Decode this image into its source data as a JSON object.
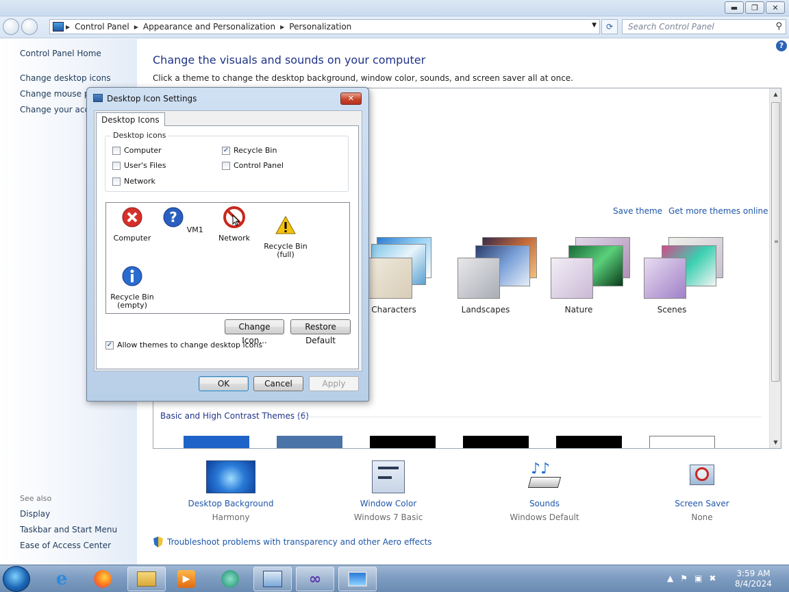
{
  "address_bar": {
    "segments": [
      "Control Panel",
      "Appearance and Personalization",
      "Personalization"
    ],
    "search_placeholder": "Search Control Panel"
  },
  "left_pane": {
    "home": "Control Panel Home",
    "links": [
      "Change desktop icons",
      "Change mouse po",
      "Change your acco"
    ],
    "see_also_label": "See also",
    "see_also": [
      "Display",
      "Taskbar and Start Menu",
      "Ease of Access Center"
    ]
  },
  "main": {
    "title": "Change the visuals and sounds on your computer",
    "subtitle": "Click a theme to change the desktop background, window color, sounds, and screen saver all at once.",
    "save_theme": "Save theme",
    "get_more": "Get more themes online",
    "themes": [
      "Characters",
      "Landscapes",
      "Nature",
      "Scenes"
    ],
    "basic_header": "Basic and High Contrast Themes (6)",
    "help": "?"
  },
  "bottom": {
    "items": [
      {
        "label": "Desktop Background",
        "value": "Harmony"
      },
      {
        "label": "Window Color",
        "value": "Windows 7 Basic"
      },
      {
        "label": "Sounds",
        "value": "Windows Default"
      },
      {
        "label": "Screen Saver",
        "value": "None"
      }
    ],
    "troubleshoot": "Troubleshoot problems with transparency and other Aero effects"
  },
  "dialog": {
    "title": "Desktop Icon Settings",
    "tab": "Desktop Icons",
    "group_label": "Desktop icons",
    "checkboxes": [
      {
        "label": "Computer",
        "checked": false
      },
      {
        "label": "Recycle Bin",
        "checked": true
      },
      {
        "label": "User's Files",
        "checked": false
      },
      {
        "label": "Control Panel",
        "checked": false
      },
      {
        "label": "Network",
        "checked": false
      }
    ],
    "icons": [
      {
        "label": "Computer",
        "icon": "error-icon"
      },
      {
        "label": "VM1",
        "icon": "question-icon"
      },
      {
        "label": "Network",
        "icon": "forbidden-icon"
      },
      {
        "label": "Recycle Bin\n(full)",
        "icon": "warning-icon"
      },
      {
        "label": "Recycle Bin\n(empty)",
        "icon": "info-icon"
      }
    ],
    "change_icon": "Change Icon...",
    "restore_default": "Restore Default",
    "allow_themes": "Allow themes to change desktop icons",
    "allow_themes_checked": true,
    "ok": "OK",
    "cancel": "Cancel",
    "apply": "Apply"
  },
  "taskbar": {
    "time": "3:59 AM",
    "date": "8/4/2024"
  }
}
